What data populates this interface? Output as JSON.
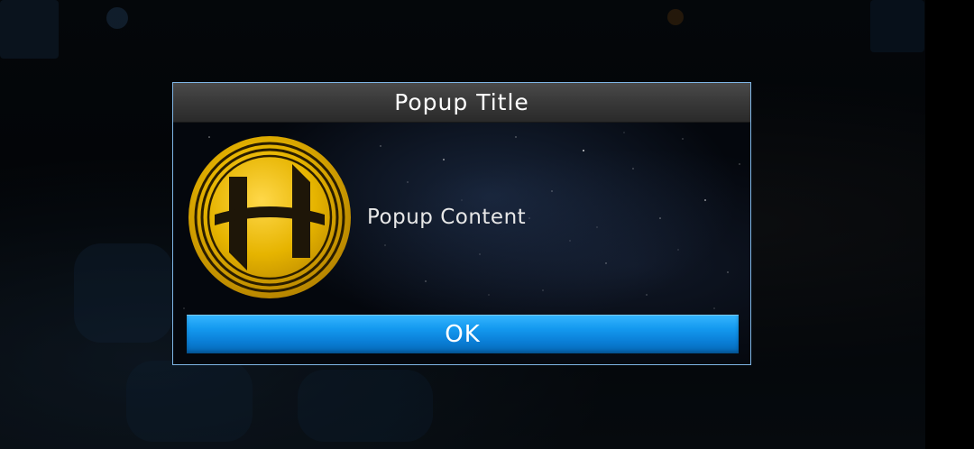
{
  "popup": {
    "title": "Popup Title",
    "content": "Popup Content",
    "ok_label": "OK",
    "icon": "gold-coin-logo-icon"
  },
  "colors": {
    "popup_border": "#7fb6e6",
    "header_bg": "#3a3a3a",
    "button_blue": "#149af0",
    "coin_gold": "#e6b800"
  }
}
